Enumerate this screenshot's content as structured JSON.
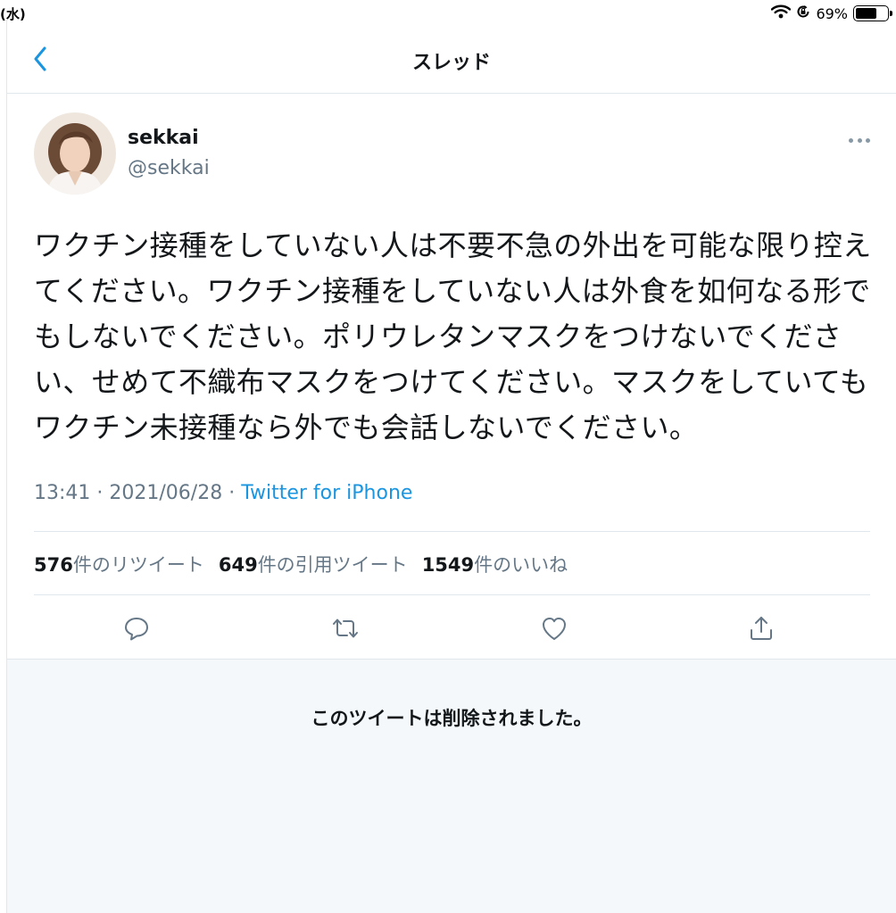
{
  "status_bar": {
    "left_text": "(水)",
    "battery_percent": "69%",
    "battery_level": 0.69
  },
  "header": {
    "title": "スレッド",
    "back_icon": "chevron-left-icon"
  },
  "tweet": {
    "display_name": "sekkai",
    "handle": "@sekkai",
    "text": "ワクチン接種をしていない人は不要不急の外出を可能な限り控えてください。ワクチン接種をしていない人は外食を如何なる形でもしないでください。ポリウレタンマスクをつけないでください、せめて不織布マスクをつけてください。マスクをしていてもワクチン未接種なら外でも会話しないでください。",
    "time": "13:41",
    "date": "2021/06/28",
    "source": "Twitter for iPhone",
    "stats": {
      "retweets_count": "576",
      "retweets_label": "件のリツイート",
      "quotes_count": "649",
      "quotes_label": "件の引用ツイート",
      "likes_count": "1549",
      "likes_label": "件のいいね"
    }
  },
  "deleted_notice": "このツイートは削除されました。",
  "colors": {
    "accent": "#1b95e0",
    "icon": "#657786",
    "text": "#14171a",
    "muted": "#657786",
    "divider": "#e1e8ed",
    "panel": "#f5f8fa"
  }
}
